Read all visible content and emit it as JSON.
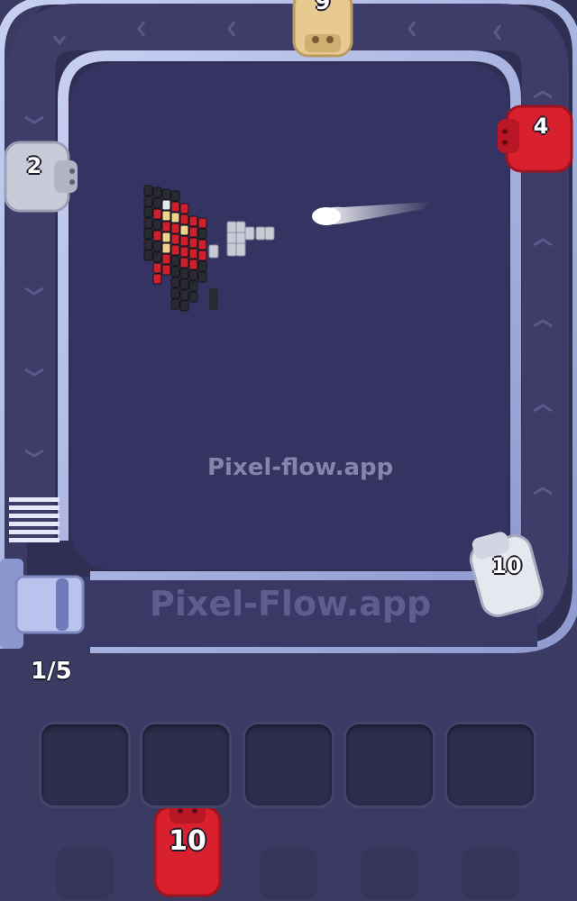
{
  "watermark": {
    "center": "Pixel-flow.app",
    "conveyor": "Pixel-Flow.app"
  },
  "conveyor": {
    "shooters": [
      {
        "id": "top",
        "count": "9",
        "color": "#e8c98f"
      },
      {
        "id": "right-top",
        "count": "4",
        "color": "#d9202e"
      },
      {
        "id": "left",
        "count": "2",
        "color": "#c9ccd8"
      },
      {
        "id": "right-bottom",
        "count": "10",
        "color": "#e6e8f0"
      }
    ],
    "queue_counter": "1/5"
  },
  "slots": {
    "count": 5
  },
  "next_shooter": {
    "count": "10",
    "color": "#d9202e"
  },
  "colors": {
    "background": "#3b3a62",
    "track": "#a9b3e0",
    "board": "#343361"
  }
}
